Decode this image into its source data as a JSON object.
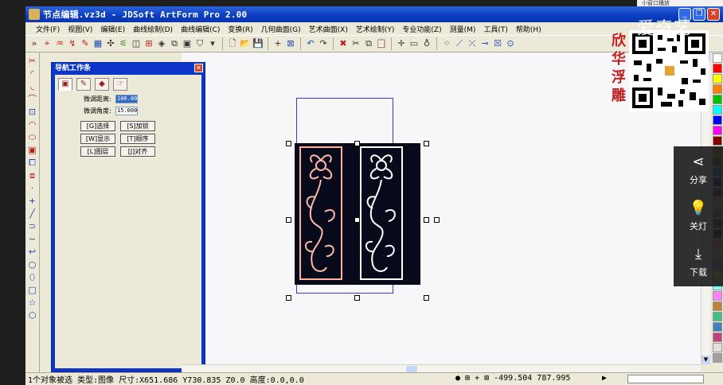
{
  "window": {
    "title": "节点编辑.vz3d - JDSoft ArtForm Pro 2.00"
  },
  "top_tab": {
    "label": "小窗口播放"
  },
  "menu": [
    "文件(F)",
    "视图(V)",
    "编辑(E)",
    "曲线绘制(D)",
    "曲线编辑(C)",
    "变换(R)",
    "几何曲面(G)",
    "艺术曲面(X)",
    "艺术绘制(Y)",
    "专业功能(Z)",
    "测量(M)",
    "工具(T)",
    "帮助(H)"
  ],
  "nav_panel": {
    "title": "导航工作条",
    "fields": [
      {
        "label": "微调距离:",
        "value": "100.00"
      },
      {
        "label": "微调角度:",
        "value": "15.000"
      }
    ],
    "buttons": [
      "[G]选择",
      "[S]加锁",
      "[W]显示",
      "[T]顺序",
      "[L]图层",
      "[J]对齐"
    ]
  },
  "status": {
    "text": "1个对象被选 类型:图像 尺寸:X651.686 Y730.835 Z0.0 高度:0.0,0.0",
    "coords": "-499.504 787.995"
  },
  "overlay": {
    "watermark": "爱奇艺",
    "brand": "欣华浮雕",
    "share": [
      {
        "icon": "share-icon",
        "label": "分享"
      },
      {
        "icon": "lightbulb-icon",
        "label": "关灯"
      },
      {
        "icon": "download-icon",
        "label": "下载"
      }
    ]
  },
  "colors": {
    "titlebar": "#0a3cc0",
    "canvas": "#f7f7fa",
    "image_bg": "#060a1a",
    "palette": [
      "#ffffff",
      "#ff0000",
      "#ffff00",
      "#ff8000",
      "#00c000",
      "#00ffff",
      "#0000ff",
      "#ff00ff",
      "#800000",
      "#808000",
      "#008000",
      "#008080",
      "#000080",
      "#800080",
      "#c0c0c0",
      "#808080",
      "#404040",
      "#000000",
      "#ff8080",
      "#80ff80",
      "#8080ff",
      "#ffff80",
      "#80ffff",
      "#ff80ff",
      "#c08040",
      "#40c080",
      "#4080c0",
      "#c04080",
      "#e0e0e0",
      "#a0a0a0"
    ]
  }
}
